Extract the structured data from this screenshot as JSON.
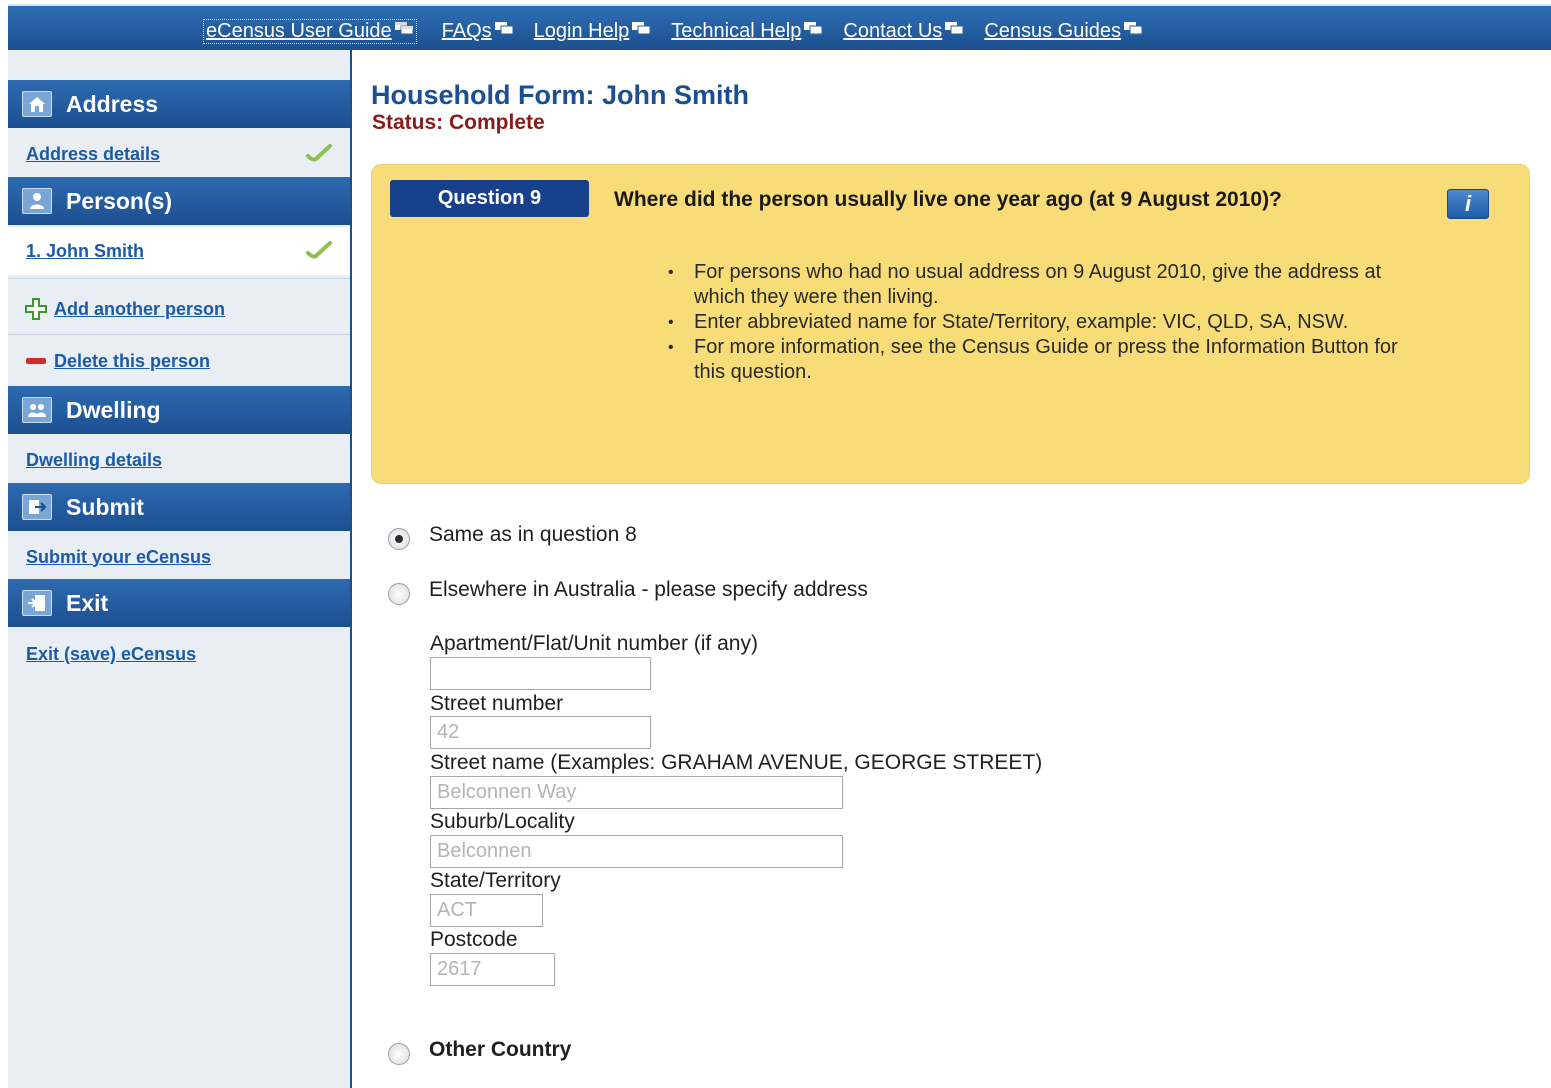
{
  "topnav": {
    "links": [
      {
        "label": "eCensus User Guide"
      },
      {
        "label": "FAQs"
      },
      {
        "label": "Login Help"
      },
      {
        "label": "Technical Help"
      },
      {
        "label": "Contact Us"
      },
      {
        "label": "Census Guides"
      }
    ]
  },
  "sidebar": {
    "address": {
      "heading": "Address",
      "link": "Address details"
    },
    "persons": {
      "heading": "Person(s)",
      "person": "1. John Smith",
      "add": "Add another person",
      "delete": "Delete this person"
    },
    "dwelling": {
      "heading": "Dwelling",
      "link": "Dwelling details"
    },
    "submit": {
      "heading": "Submit",
      "link": "Submit your eCensus"
    },
    "exit": {
      "heading": "Exit",
      "link": "Exit (save) eCensus"
    }
  },
  "form": {
    "title": "Household Form: John Smith",
    "status": "Status: Complete"
  },
  "question": {
    "badge": "Question 9",
    "text": "Where did the person usually live one year ago (at 9 August 2010)?",
    "info_glyph": "i",
    "bullets": [
      "For persons who had no usual address on 9 August 2010, give the address at which they were then living.",
      "Enter abbreviated name for State/Territory, example: VIC, QLD, SA, NSW.",
      "For more information, see the Census Guide or press the Information Button for this question."
    ]
  },
  "options": {
    "same": "Same as in question 8",
    "elsewhere": "Elsewhere in Australia - please specify address",
    "other": "Other Country"
  },
  "address_fields": {
    "apartment": {
      "label": "Apartment/Flat/Unit number (if any)",
      "value": ""
    },
    "street_number": {
      "label": "Street number",
      "value": "42"
    },
    "street_name": {
      "label": "Street name (Examples: GRAHAM AVENUE, GEORGE STREET)",
      "value": "Belconnen Way"
    },
    "suburb": {
      "label": "Suburb/Locality",
      "value": "Belconnen"
    },
    "state": {
      "label": "State/Territory",
      "value": "ACT"
    },
    "postcode": {
      "label": "Postcode",
      "value": "2617"
    }
  },
  "colors": {
    "nav_blue": "#1b4f8f",
    "question_bg": "#f7dc77",
    "status_red": "#8b1a1a",
    "link_blue": "#1a5aa6"
  },
  "selected_option": "same"
}
